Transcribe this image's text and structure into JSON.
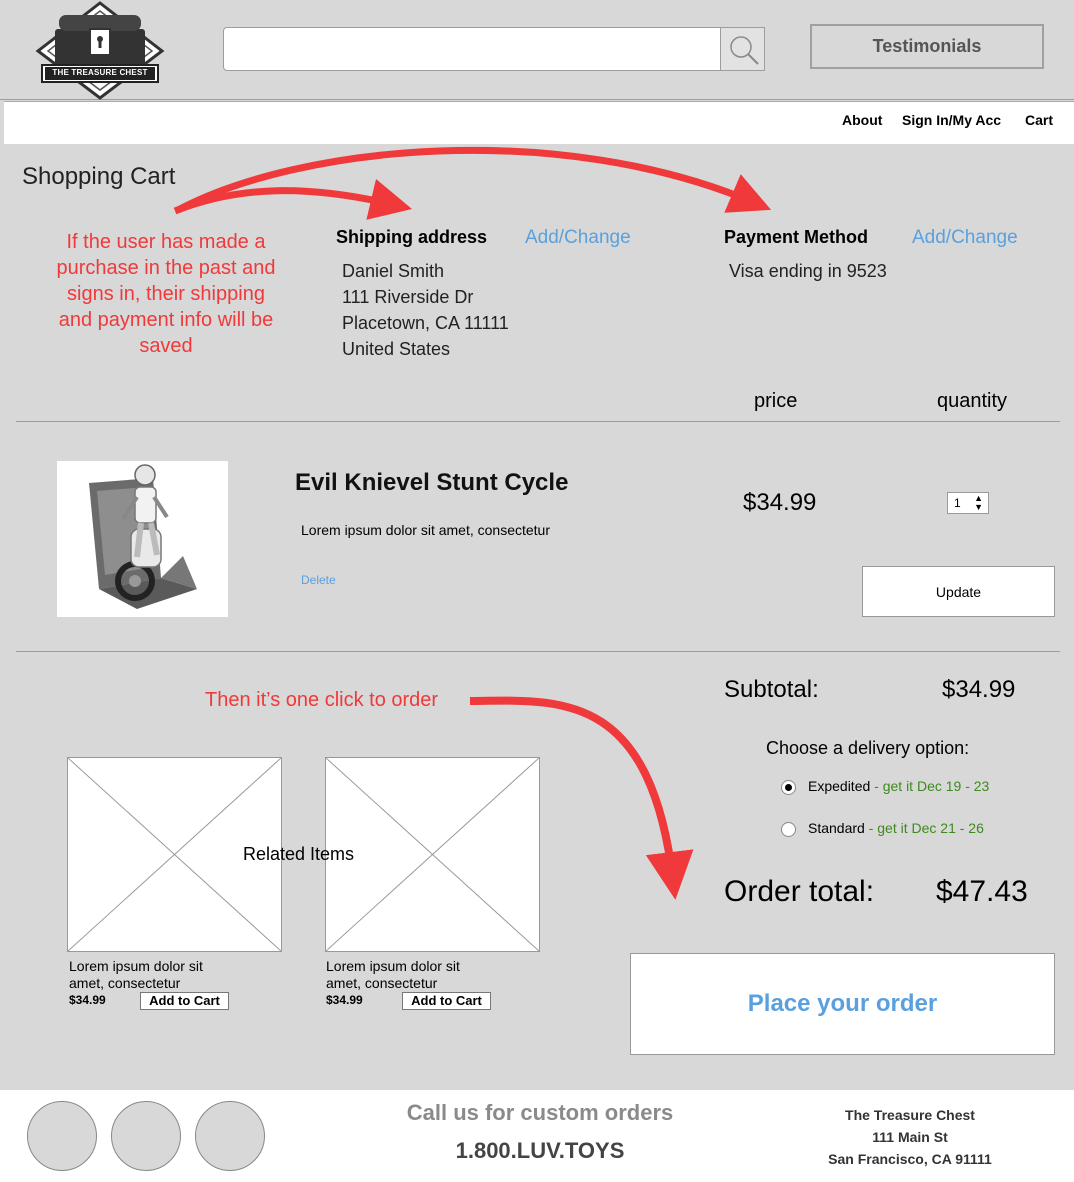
{
  "header": {
    "logo_text": "THE TREASURE CHEST",
    "search_placeholder": "",
    "testimonials_label": "Testimonials"
  },
  "nav": {
    "about": "About",
    "signin": "Sign In/My Acc",
    "cart": "Cart"
  },
  "cart": {
    "title": "Shopping Cart",
    "annotation_saved": [
      "If the user has made a",
      "purchase in the past and",
      "signs in, their shipping",
      "and payment info will be",
      "saved"
    ],
    "shipping_label": "Shipping address",
    "shipping_change": "Add/Change",
    "shipping_lines": [
      "Daniel Smith",
      "111 Riverside Dr",
      "Placetown, CA 11111",
      "United States"
    ],
    "payment_label": "Payment Method",
    "payment_change": "Add/Change",
    "payment_value": "Visa ending in 9523",
    "col_price": "price",
    "col_quantity": "quantity"
  },
  "item": {
    "name": "Evil Knievel Stunt Cycle",
    "description": "Lorem ipsum dolor sit amet, consectetur",
    "delete_label": "Delete",
    "price": "$34.99",
    "quantity": "1",
    "update_label": "Update"
  },
  "summary": {
    "annotation_click": "Then it’s one click to order",
    "subtotal_label": "Subtotal:",
    "subtotal_value": "$34.99",
    "delivery_prompt": "Choose a delivery option:",
    "options": [
      {
        "label": "Expedited",
        "eta": " - get it Dec 19 - 23",
        "selected": true
      },
      {
        "label": "Standard",
        "eta": " - get it Dec 21 - 26",
        "selected": false
      }
    ],
    "order_total_label": "Order total:",
    "order_total_value": "$47.43",
    "place_order_label": "Place your order"
  },
  "related": {
    "title": "Related Items",
    "items": [
      {
        "text1": "Lorem ipsum dolor sit",
        "text2": "amet, consectetur",
        "price": "$34.99",
        "add_label": "Add to Cart"
      },
      {
        "text1": "Lorem ipsum dolor sit",
        "text2": "amet, consectetur",
        "price": "$34.99",
        "add_label": "Add to Cart"
      }
    ]
  },
  "footer": {
    "call_text": "Call us for custom orders",
    "phone": "1.800.LUV.TOYS",
    "company": "The Treasure Chest",
    "street": "111 Main St",
    "city": "San Francisco, CA 91111"
  },
  "colors": {
    "annotation": "#f0393a",
    "link": "#5aa0de",
    "eta": "#3e8a1e",
    "background": "#d8d8d8"
  }
}
